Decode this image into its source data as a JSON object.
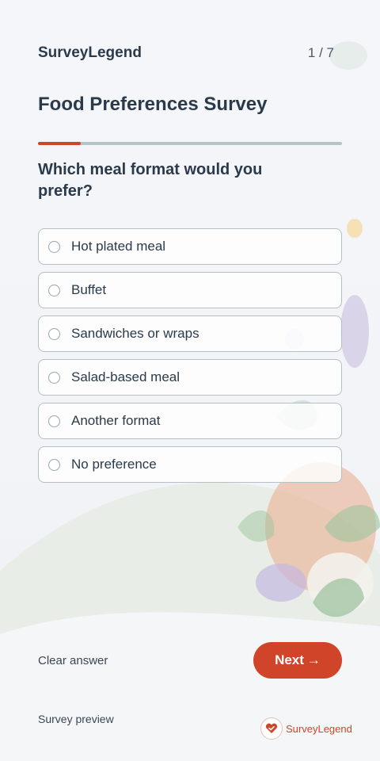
{
  "header": {
    "brand": "SurveyLegend",
    "step": "1 / 7"
  },
  "survey": {
    "title": "Food Preferences Survey",
    "progress_percent": 14
  },
  "question": {
    "text": "Which meal format would you prefer?",
    "options": [
      "Hot plated meal",
      "Buffet",
      "Sandwiches or wraps",
      "Salad-based meal",
      "Another format",
      "No preference"
    ]
  },
  "actions": {
    "clear_label": "Clear answer",
    "next_label": "Next",
    "next_arrow": "→"
  },
  "footer": {
    "preview_label": "Survey preview",
    "logo_text": "SurveyLegend"
  },
  "colors": {
    "accent": "#d0442a",
    "text": "#2b3a4a",
    "border": "#b4c0c4",
    "progress_track": "#b7c3c6"
  }
}
